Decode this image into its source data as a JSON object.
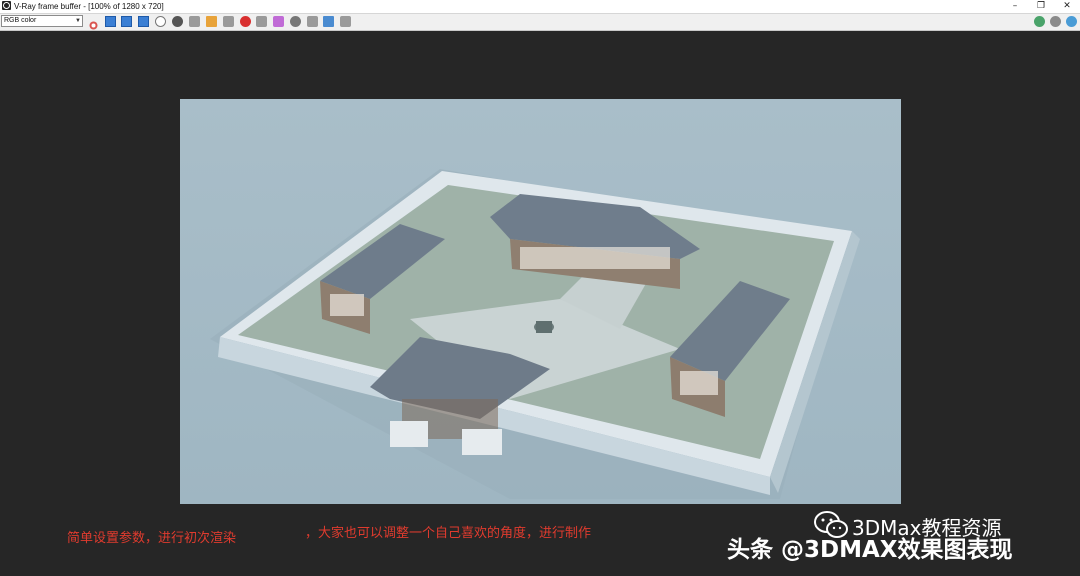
{
  "window": {
    "title": "V-Ray frame buffer - [100% of 1280 x 720]",
    "minimize": "–",
    "restore": "❐",
    "close": "✕"
  },
  "toolbar": {
    "channel": "RGB color",
    "right_icons": [
      "globe-icon",
      "gear-icon",
      "lens-icon"
    ]
  },
  "captions": {
    "left": "简单设置参数，进行初次渲染",
    "right": "，大家也可以调整一个自己喜欢的角度，进行制作"
  },
  "watermark": {
    "account": "3DMax教程资源",
    "main": "头条 @3DMAX效果图表现"
  }
}
